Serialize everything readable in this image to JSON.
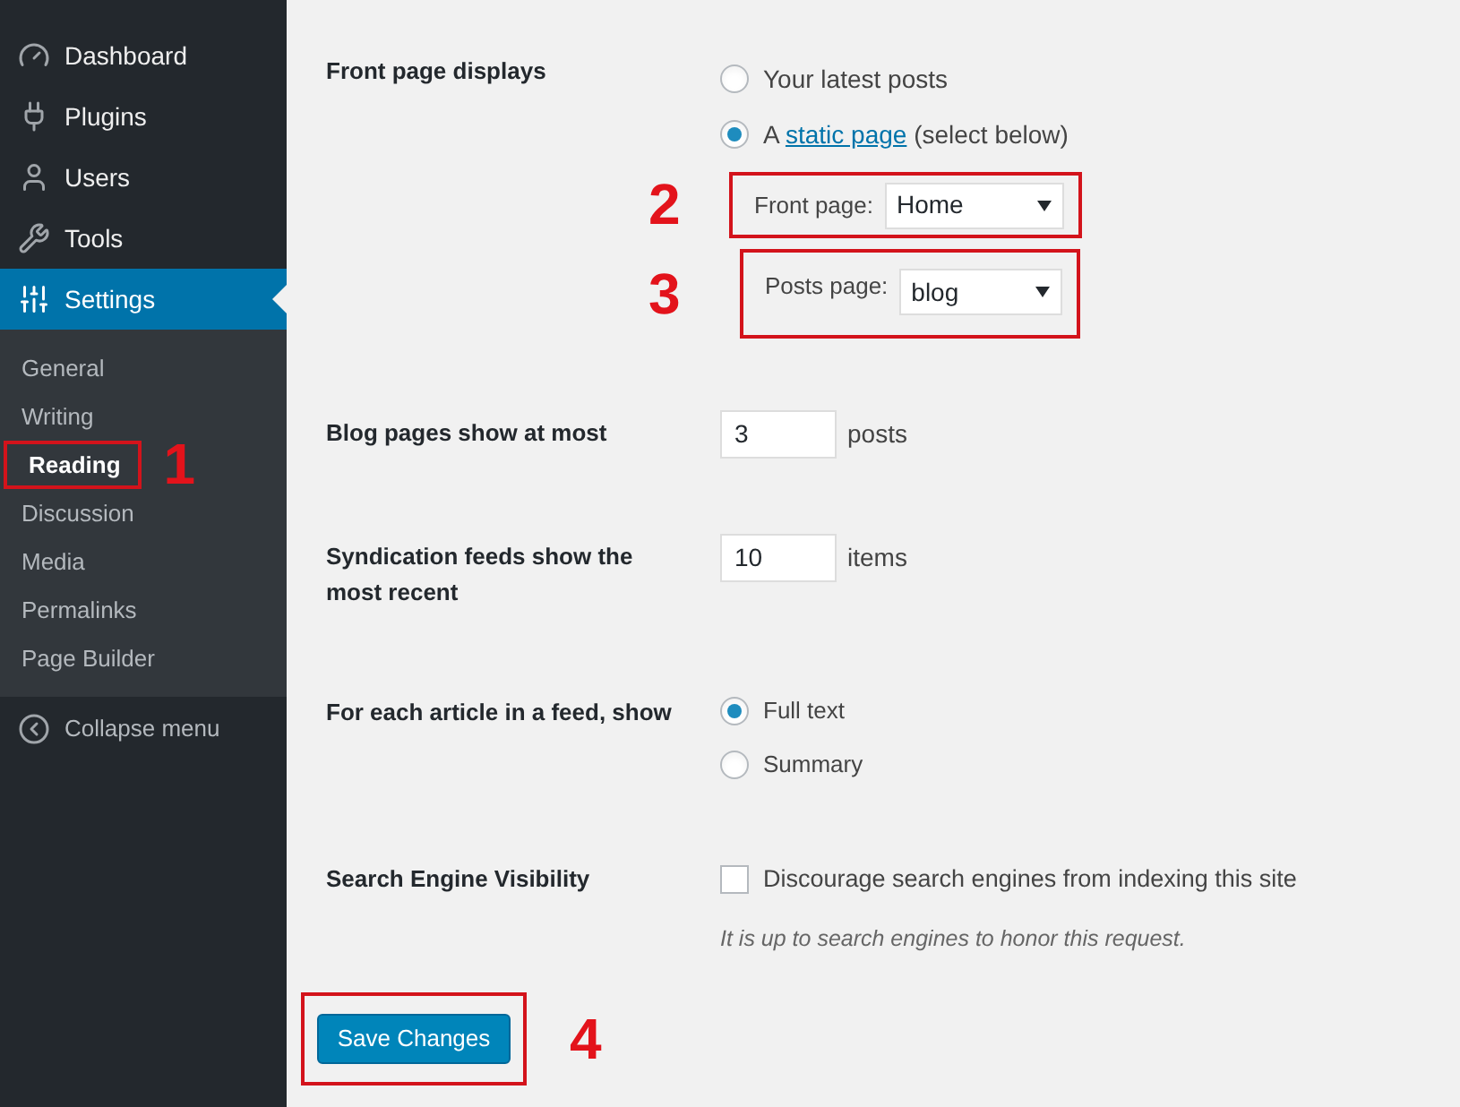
{
  "sidebar": {
    "menu": [
      {
        "label": "Dashboard",
        "kind": "gauge",
        "selected": false
      },
      {
        "label": "Plugins",
        "kind": "plug",
        "selected": false
      },
      {
        "label": "Users",
        "kind": "user",
        "selected": false
      },
      {
        "label": "Tools",
        "kind": "wrench",
        "selected": false
      },
      {
        "label": "Settings",
        "kind": "sliders",
        "selected": true
      }
    ],
    "submenu": [
      {
        "label": "General",
        "selected": false
      },
      {
        "label": "Writing",
        "selected": false
      },
      {
        "label": "Reading",
        "selected": true,
        "annotation": "1"
      },
      {
        "label": "Discussion",
        "selected": false
      },
      {
        "label": "Media",
        "selected": false
      },
      {
        "label": "Permalinks",
        "selected": false
      },
      {
        "label": "Page Builder",
        "selected": false
      }
    ],
    "collapse": "Collapse menu"
  },
  "front_page_displays": {
    "label": "Front page displays",
    "options": [
      {
        "before": "Your latest posts",
        "selected": false
      },
      {
        "before": "A",
        "link": "static page",
        "after": "(select below)",
        "selected": true
      }
    ],
    "selects": [
      {
        "label": "Front page:",
        "value": "Home",
        "annotation": "2"
      },
      {
        "label": "Posts page:",
        "value": "blog",
        "annotation": "3"
      }
    ]
  },
  "blog_pages": {
    "label": "Blog pages show at most",
    "value": "3",
    "unit": "posts"
  },
  "syndication": {
    "label": "Syndication feeds show the most recent",
    "value": "10",
    "unit": "items"
  },
  "feed_article": {
    "label": "For each article in a feed, show",
    "options": [
      {
        "label": "Full text",
        "selected": true
      },
      {
        "label": "Summary",
        "selected": false
      }
    ]
  },
  "search_visibility": {
    "label": "Search Engine Visibility",
    "checkbox": "Discourage search engines from indexing this site",
    "checked": false,
    "note": "It is up to search engines to honor this request."
  },
  "save": {
    "label": "Save Changes",
    "annotation": "4"
  }
}
